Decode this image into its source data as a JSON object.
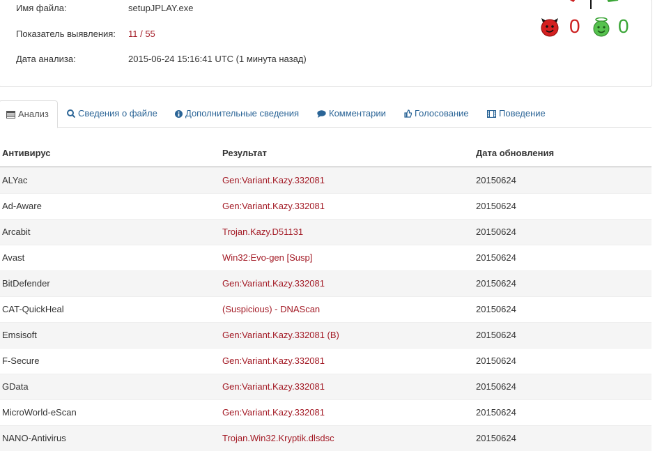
{
  "summary": {
    "filename_label": "Имя файла:",
    "filename_value": "setupJPLAY.exe",
    "ratio_label": "Показатель выявления:",
    "ratio_value": "11 / 55",
    "date_label": "Дата анализа:",
    "date_value": "2015-06-24 15:16:41 UTC (1 минута назад)"
  },
  "votes": {
    "malicious_count": "0",
    "harmless_count": "0",
    "malicious_icon": "devil-face-icon",
    "harmless_icon": "angel-face-icon",
    "malicious_color": "#cc1f1f",
    "harmless_color": "#3aa536"
  },
  "tabs": [
    {
      "label": "Анализ",
      "icon": "table-icon",
      "active": true
    },
    {
      "label": "Сведения о файле",
      "icon": "magnifier-icon"
    },
    {
      "label": "Дополнительные сведения",
      "icon": "info-icon"
    },
    {
      "label": "Комментарии",
      "icon": "comment-icon"
    },
    {
      "label": "Голосование",
      "icon": "thumb-icon"
    },
    {
      "label": "Поведение",
      "icon": "film-icon"
    }
  ],
  "table": {
    "headers": [
      "Антивирус",
      "Результат",
      "Дата обновления"
    ],
    "rows": [
      [
        "ALYac",
        "Gen:Variant.Kazy.332081",
        "20150624"
      ],
      [
        "Ad-Aware",
        "Gen:Variant.Kazy.332081",
        "20150624"
      ],
      [
        "Arcabit",
        "Trojan.Kazy.D51131",
        "20150624"
      ],
      [
        "Avast",
        "Win32:Evo-gen [Susp]",
        "20150624"
      ],
      [
        "BitDefender",
        "Gen:Variant.Kazy.332081",
        "20150624"
      ],
      [
        "CAT-QuickHeal",
        "(Suspicious) - DNAScan",
        "20150624"
      ],
      [
        "Emsisoft",
        "Gen:Variant.Kazy.332081 (B)",
        "20150624"
      ],
      [
        "F-Secure",
        "Gen:Variant.Kazy.332081",
        "20150624"
      ],
      [
        "GData",
        "Gen:Variant.Kazy.332081",
        "20150624"
      ],
      [
        "MicroWorld-eScan",
        "Gen:Variant.Kazy.332081",
        "20150624"
      ],
      [
        "NANO-Antivirus",
        "Trojan.Win32.Kryptik.dlsdsc",
        "20150624"
      ]
    ]
  },
  "colors": {
    "link": "#2a6496",
    "detection": "#a31a25",
    "stripe": "#f5f5f5",
    "border": "#dddddd"
  }
}
